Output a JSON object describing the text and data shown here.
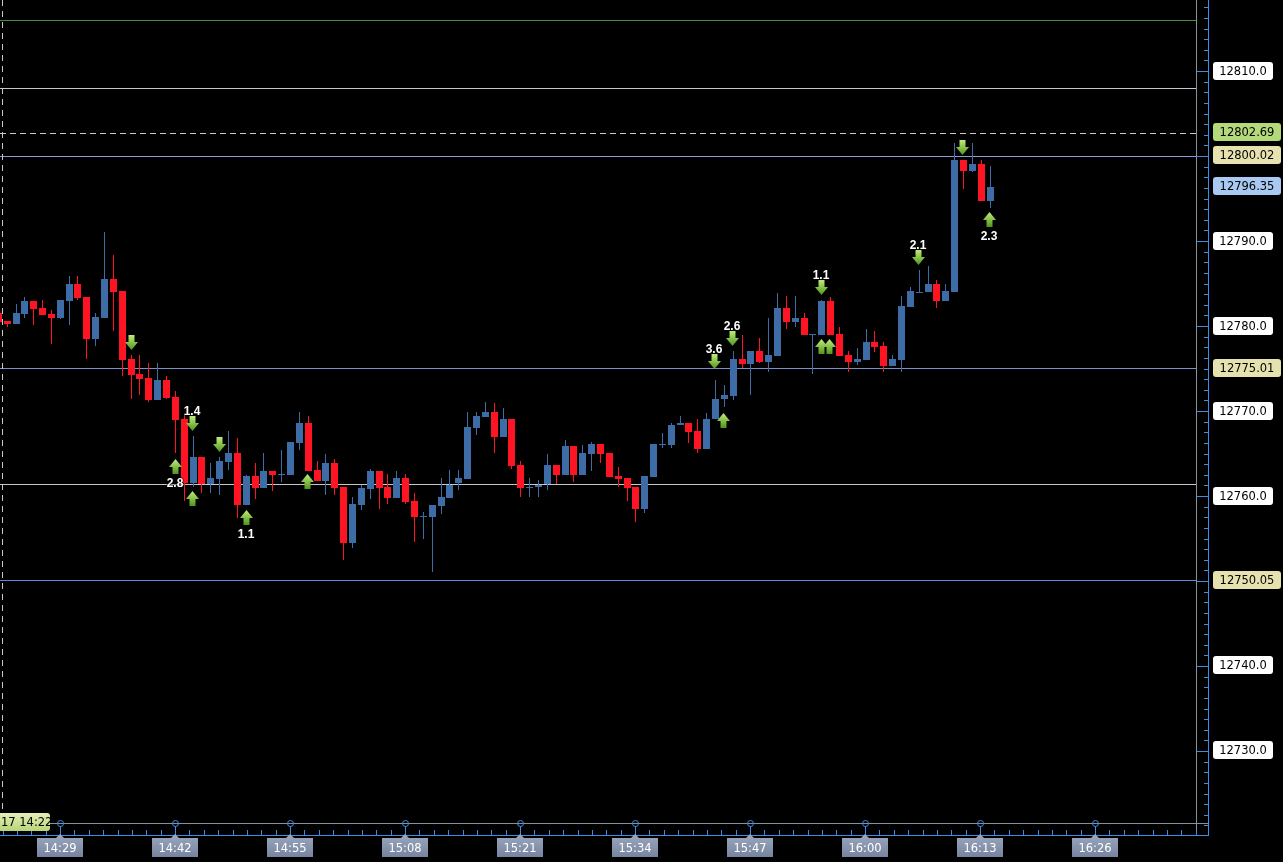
{
  "chart": {
    "signals": [
      {
        "kind": "down"
      },
      {
        "kind": "up",
        "label": "2.8"
      },
      {
        "kind": "down",
        "label": "1.4"
      },
      {
        "kind": "up"
      },
      {
        "kind": "down"
      },
      {
        "kind": "up",
        "label": "1.1"
      },
      {
        "kind": "up"
      },
      {
        "kind": "down",
        "label": "3.6"
      },
      {
        "kind": "up"
      },
      {
        "kind": "down",
        "label": "2.6"
      },
      {
        "kind": "down",
        "label": "1.1"
      },
      {
        "kind": "up"
      },
      {
        "kind": "up"
      },
      {
        "kind": "down",
        "label": "2.1"
      },
      {
        "kind": "down"
      },
      {
        "kind": "up",
        "label": "2.3"
      }
    ],
    "price_axis": [
      {
        "kind": "tick",
        "label": "12810.0"
      },
      {
        "kind": "marker",
        "label": "12802.69",
        "color": "#b3d97a"
      },
      {
        "kind": "marker",
        "label": "12800.02",
        "color": "#e6e2b0"
      },
      {
        "kind": "marker",
        "label": "12796.35",
        "color": "#a9c9f2"
      },
      {
        "kind": "tick",
        "label": "12790.0"
      },
      {
        "kind": "tick",
        "label": "12780.0"
      },
      {
        "kind": "marker",
        "label": "12775.01",
        "color": "#e6e2b0"
      },
      {
        "kind": "tick",
        "label": "12770.0"
      },
      {
        "kind": "tick",
        "label": "12760.0"
      },
      {
        "kind": "marker",
        "label": "12750.05",
        "color": "#e6e2b0"
      },
      {
        "kind": "tick",
        "label": "12740.0"
      },
      {
        "kind": "tick",
        "label": "12730.0"
      }
    ],
    "time_axis": [
      "14:29",
      "14:42",
      "14:55",
      "15:08",
      "15:21",
      "15:34",
      "15:47",
      "16:00",
      "16:13",
      "16:26"
    ],
    "cursor_time": "17 14:22"
  }
}
